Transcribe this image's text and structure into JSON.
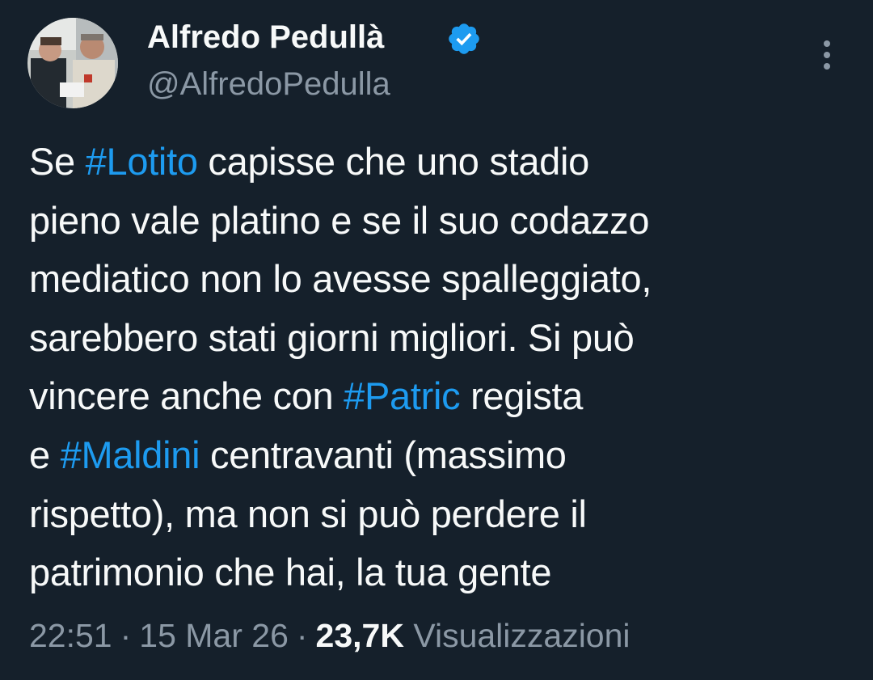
{
  "author": {
    "display_name": "Alfredo Pedullà",
    "handle": "@AlfredoPedulla",
    "verified": true,
    "verified_color": "#1d9bf0"
  },
  "tweet": {
    "lines": [
      [
        {
          "text": "Se "
        },
        {
          "text": "#Lotito",
          "hashtag": true
        },
        {
          "text": " capisse che uno stadio"
        }
      ],
      [
        {
          "text": "pieno vale platino e se il suo codazzo"
        }
      ],
      [
        {
          "text": "mediatico non lo avesse spalleggiato,"
        }
      ],
      [
        {
          "text": "sarebbero stati giorni migliori. Si può"
        }
      ],
      [
        {
          "text": "vincere anche con "
        },
        {
          "text": "#Patric",
          "hashtag": true
        },
        {
          "text": " regista"
        }
      ],
      [
        {
          "text": "e "
        },
        {
          "text": "#Maldini",
          "hashtag": true
        },
        {
          "text": " centravanti (massimo"
        }
      ],
      [
        {
          "text": "rispetto), ma non si può perdere il"
        }
      ],
      [
        {
          "text": "patrimonio che hai, la tua gente"
        }
      ]
    ]
  },
  "meta": {
    "time": "22:51",
    "separator": "·",
    "date": "15 Mar 26",
    "views_count": "23,7K",
    "views_label": "Visualizzazioni"
  },
  "icons": {
    "more": "more-vertical-icon",
    "verified": "verified-badge-icon"
  },
  "colors": {
    "background": "#15202b",
    "text": "#f7f9f9",
    "secondary": "#8b98a5",
    "accent": "#1d9bf0"
  }
}
